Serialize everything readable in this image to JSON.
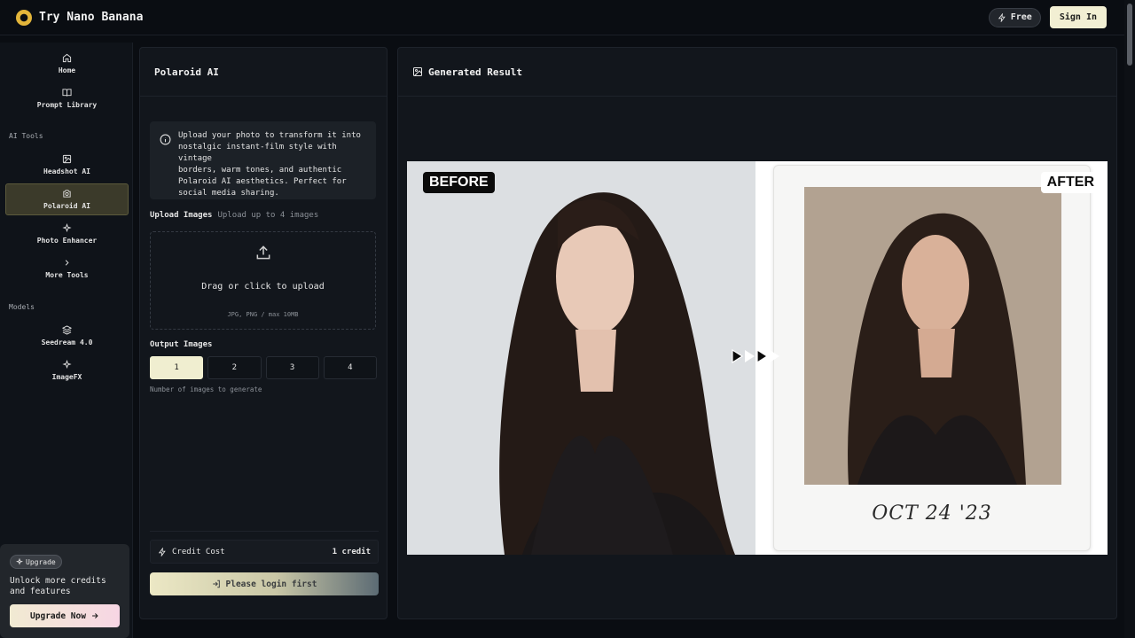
{
  "header": {
    "brand": "Try Nano Banana",
    "free_label": "Free",
    "sign_in_label": "Sign In"
  },
  "sidebar": {
    "items": [
      {
        "label": "Home",
        "icon": "home-icon"
      },
      {
        "label": "Prompt Library",
        "icon": "book-icon"
      }
    ],
    "ai_tools_label": "AI Tools",
    "ai_tools": [
      {
        "label": "Headshot AI",
        "icon": "image-icon"
      },
      {
        "label": "Polaroid AI",
        "icon": "camera-icon",
        "active": true
      },
      {
        "label": "Photo Enhancer",
        "icon": "sparkles-icon"
      },
      {
        "label": "More Tools",
        "icon": "chevron-right-icon"
      }
    ],
    "models_label": "Models",
    "models": [
      {
        "label": "Seedream 4.0",
        "icon": "layers-icon"
      },
      {
        "label": "ImageFX",
        "icon": "sparkles-icon"
      }
    ],
    "upgrade": {
      "badge": "Upgrade",
      "text": "Unlock more credits and features",
      "button": "Upgrade Now"
    }
  },
  "tool_panel": {
    "title": "Polaroid AI",
    "info_lines": [
      "Upload your photo to transform it into",
      "nostalgic instant-film style with vintage",
      "borders, warm tones, and authentic",
      "Polaroid AI aesthetics. Perfect for",
      "social media sharing."
    ],
    "upload_label": "Upload Images",
    "upload_hint": "Upload up to 4 images",
    "dropzone_text": "Drag or click to upload",
    "dropzone_sub": "JPG, PNG / max 10MB",
    "output_label": "Output Images",
    "output_options": [
      "1",
      "2",
      "3",
      "4"
    ],
    "output_selected": "1",
    "output_hint": "Number of images to generate",
    "credit_label": "Credit Cost",
    "credit_value": "1 credit",
    "login_button": "Please login first"
  },
  "result": {
    "title": "Generated Result",
    "before_label": "BEFORE",
    "after_label": "AFTER",
    "polaroid_caption": "OCT 24 '23"
  },
  "colors": {
    "background": "#0a0d12",
    "accent_cream": "#f0eed0",
    "logo_gold": "#e3b53a"
  }
}
